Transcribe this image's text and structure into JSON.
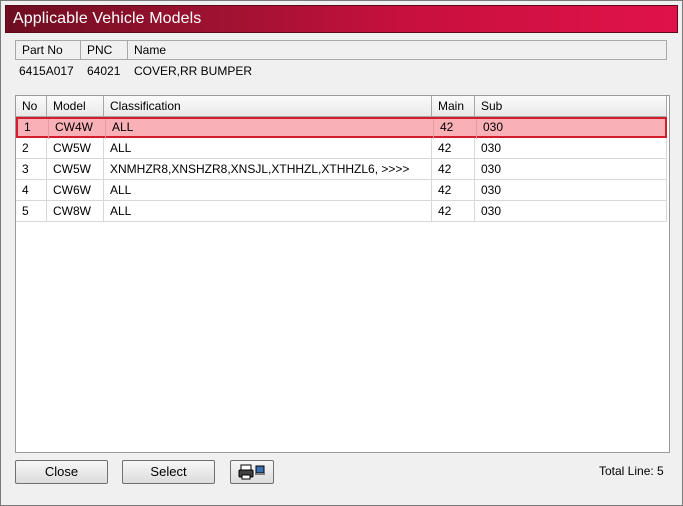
{
  "window": {
    "title": "Applicable Vehicle Models"
  },
  "part": {
    "headers": {
      "part_no": "Part No",
      "pnc": "PNC",
      "name": "Name"
    },
    "values": {
      "part_no": "6415A017",
      "pnc": "64021",
      "name": "COVER,RR BUMPER"
    }
  },
  "grid": {
    "columns": [
      "No",
      "Model",
      "Classification",
      "Main",
      "Sub"
    ],
    "rows": [
      {
        "no": "1",
        "model": "CW4W",
        "classification": "ALL",
        "main": "42",
        "sub": "030",
        "selected": true
      },
      {
        "no": "2",
        "model": "CW5W",
        "classification": "ALL",
        "main": "42",
        "sub": "030"
      },
      {
        "no": "3",
        "model": "CW5W",
        "classification": "XNMHZR8,XNSHZR8,XNSJL,XTHHZL,XTHHZL6,  >>>>",
        "main": "42",
        "sub": "030"
      },
      {
        "no": "4",
        "model": "CW6W",
        "classification": "ALL",
        "main": "42",
        "sub": "030"
      },
      {
        "no": "5",
        "model": "CW8W",
        "classification": "ALL",
        "main": "42",
        "sub": "030"
      }
    ]
  },
  "footer": {
    "close_label": "Close",
    "select_label": "Select",
    "print_icon": "printer-icon",
    "total_line": "Total Line: 5"
  },
  "colors": {
    "title_start": "#6d0d21",
    "title_end": "#e0124a",
    "selection_fill": "#f9b0b6",
    "selection_border": "#d41d2c"
  }
}
